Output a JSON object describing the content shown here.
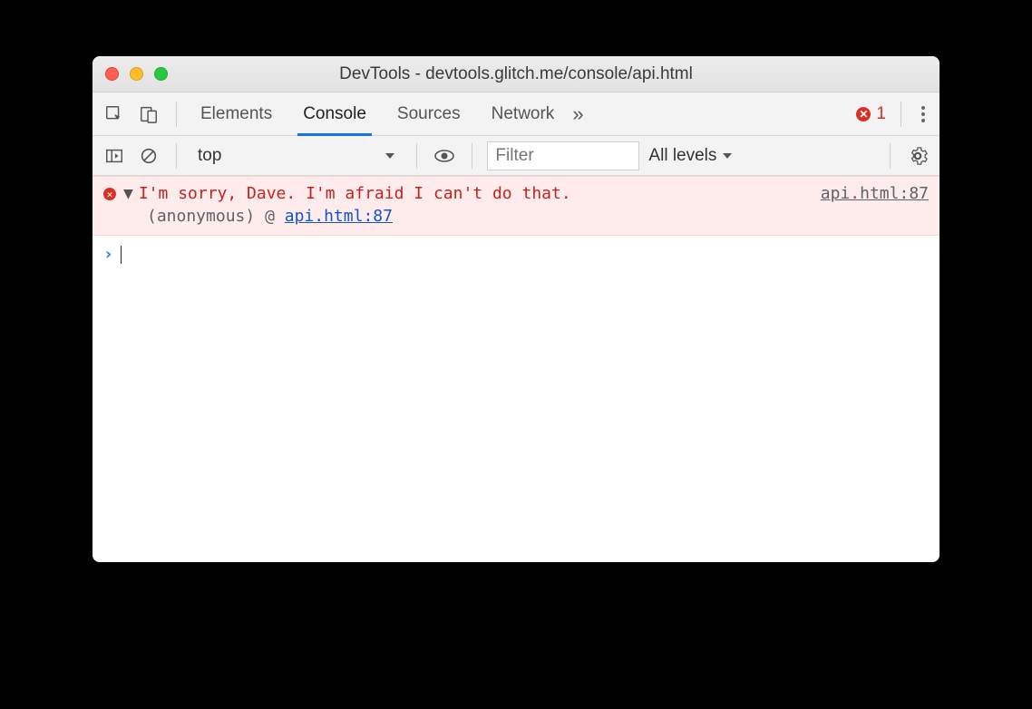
{
  "window": {
    "title": "DevTools - devtools.glitch.me/console/api.html"
  },
  "toolbar": {
    "tabs": [
      "Elements",
      "Console",
      "Sources",
      "Network"
    ],
    "active_tab": "Console",
    "error_count": "1"
  },
  "consoleToolbar": {
    "context": "top",
    "filter_placeholder": "Filter",
    "levels_label": "All levels"
  },
  "console": {
    "error": {
      "message": "I'm sorry, Dave. I'm afraid I can't do that.",
      "source": "api.html:87",
      "stack_label": "(anonymous)",
      "stack_at": "@",
      "stack_link": "api.html:87"
    }
  }
}
